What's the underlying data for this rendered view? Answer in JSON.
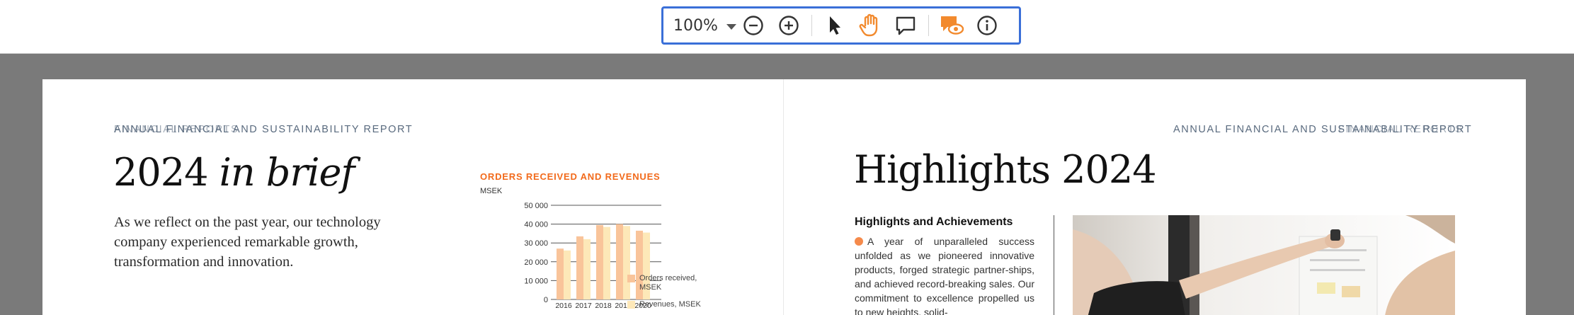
{
  "toolbar": {
    "zoom_value": "100%",
    "tools": [
      {
        "name": "zoom-out-icon"
      },
      {
        "name": "zoom-in-icon"
      },
      {
        "name": "select-pointer-icon"
      },
      {
        "name": "pan-hand-icon",
        "active": true
      },
      {
        "name": "comment-icon"
      },
      {
        "name": "view-annotations-icon"
      },
      {
        "name": "info-icon"
      }
    ],
    "accent": "#3a6fd8",
    "active_color": "#f28a2e"
  },
  "left_page": {
    "running_head": "ANNUAL FINANCIAL AND SUSTAINABILITY REPORT",
    "running_head_overlap": "FINANCIAL REPORTS",
    "title_plain": "2024 ",
    "title_italic": "in brief",
    "intro": "As we reflect on the past year, our technology company experienced remarkable growth, transformation and innovation."
  },
  "chart_data": {
    "type": "bar",
    "title": "ORDERS RECEIVED AND REVENUES",
    "unit": "MSEK",
    "categories": [
      "2016",
      "2017",
      "2018",
      "2019",
      "2020"
    ],
    "y_ticks": [
      "50 000",
      "40 000",
      "30 000",
      "20 000",
      "10 000",
      "0"
    ],
    "ylim": [
      0,
      50000
    ],
    "series": [
      {
        "name": "Orders received, MSEK",
        "color": "#f9c49a",
        "values": [
          27000,
          33500,
          39500,
          40000,
          36500
        ]
      },
      {
        "name": "Revenues, MSEK",
        "color": "#fde8b8",
        "values": [
          26000,
          32000,
          38500,
          39000,
          35500
        ]
      }
    ],
    "legend_position": "right"
  },
  "right_page": {
    "running_head": "ANNUAL FINANCIAL AND SUSTAINABILITY REPORT",
    "running_head_overlap": "FINANCIAL REPORTS",
    "title": "Highlights 2024",
    "subhead": "Highlights and Achievements",
    "body": "A year of unparalleled success unfolded as we pioneered innovative products, forged strategic partner-ships, and achieved record-breaking sales. Our commitment to excellence propelled us to new heights, solid-"
  }
}
